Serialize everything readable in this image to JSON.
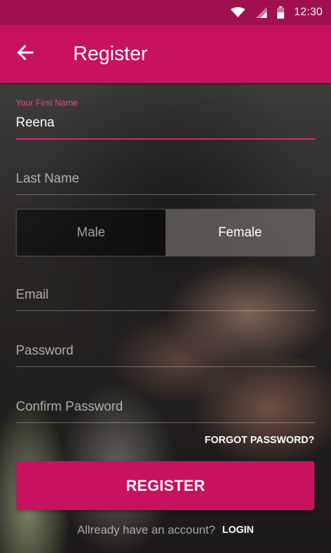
{
  "status_bar": {
    "time": "12:30"
  },
  "app_bar": {
    "title": "Register"
  },
  "form": {
    "first_name": {
      "label": "Your First Name",
      "value": "Reena"
    },
    "last_name": {
      "placeholder": "Last Name"
    },
    "gender": {
      "options": [
        "Male",
        "Female"
      ],
      "selected": "Female"
    },
    "email": {
      "placeholder": "Email"
    },
    "password": {
      "placeholder": "Password"
    },
    "confirm_password": {
      "placeholder": "Confirm Password"
    },
    "forgot_password": "FORGOT PASSWORD?",
    "register_button": "REGISTER"
  },
  "footer": {
    "prompt": "Allready have an account?",
    "login": "LOGIN"
  },
  "colors": {
    "primary": "#c8115f",
    "status_bar": "#a0104f",
    "accent": "#e0237a"
  },
  "icons": {
    "back": "arrow-left-icon",
    "wifi": "wifi-icon",
    "signal": "signal-icon",
    "battery": "battery-icon"
  }
}
